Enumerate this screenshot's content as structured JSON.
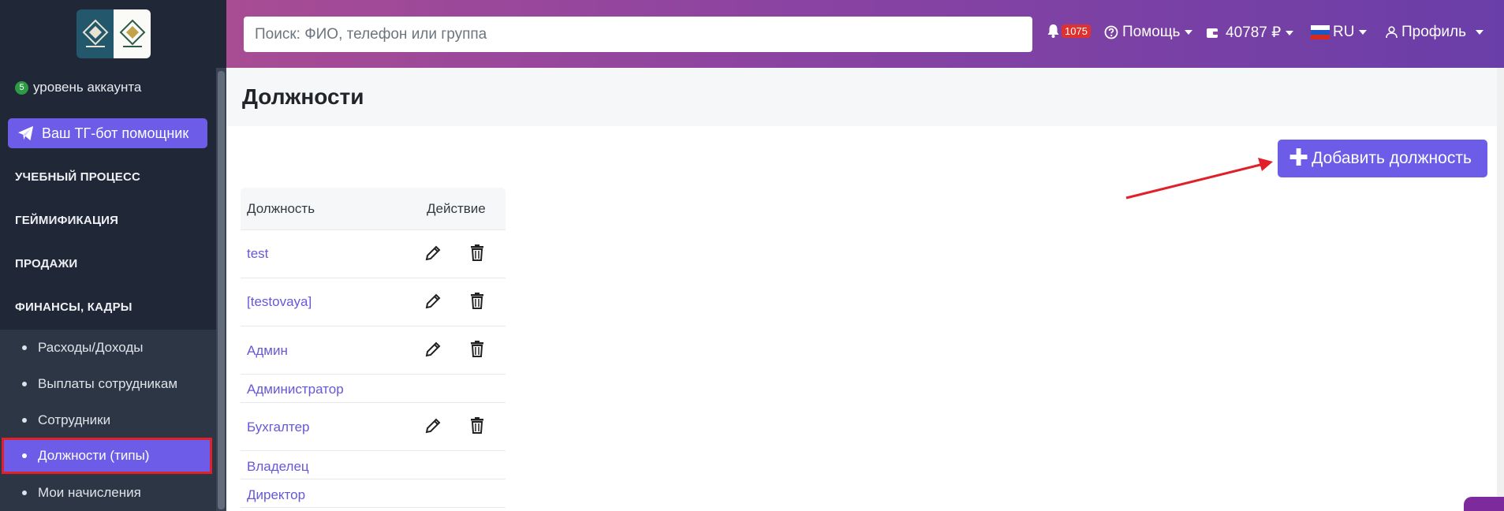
{
  "sidebar": {
    "account_level_badge": "5",
    "account_level_text": "уровень аккаунта",
    "tg_button": "Ваш ТГ-бот помощник",
    "sections": [
      {
        "label": "УЧЕБНЫЙ ПРОЦЕСС"
      },
      {
        "label": "ГЕЙМИФИКАЦИЯ"
      },
      {
        "label": "ПРОДАЖИ"
      },
      {
        "label": "ФИНАНСЫ, КАДРЫ"
      }
    ],
    "submenu": [
      {
        "label": "Расходы/Доходы"
      },
      {
        "label": "Выплаты сотрудникам"
      },
      {
        "label": "Сотрудники"
      },
      {
        "label": "Должности (типы)",
        "active": true
      },
      {
        "label": "Мои начисления"
      }
    ]
  },
  "header": {
    "search_placeholder": "Поиск: ФИО, телефон или группа",
    "notifications_count": "1075",
    "help_label": "Помощь",
    "balance": "40787 ₽",
    "language": "RU",
    "profile_label": "Профиль"
  },
  "main": {
    "page_title": "Должности",
    "add_button": "Добавить должность",
    "table": {
      "headers": [
        "Должность",
        "Действие"
      ],
      "rows": [
        {
          "name": "test",
          "editable": true
        },
        {
          "name": "[testovaya]",
          "editable": true
        },
        {
          "name": "Админ",
          "editable": true
        },
        {
          "name": "Администратор",
          "editable": false
        },
        {
          "name": "Бухгалтер",
          "editable": true
        },
        {
          "name": "Владелец",
          "editable": false
        },
        {
          "name": "Директор",
          "editable": false
        }
      ]
    }
  },
  "colors": {
    "accent": "#6c5ce7",
    "sidebar_bg": "#202837",
    "annotation_red": "#e0202a"
  }
}
